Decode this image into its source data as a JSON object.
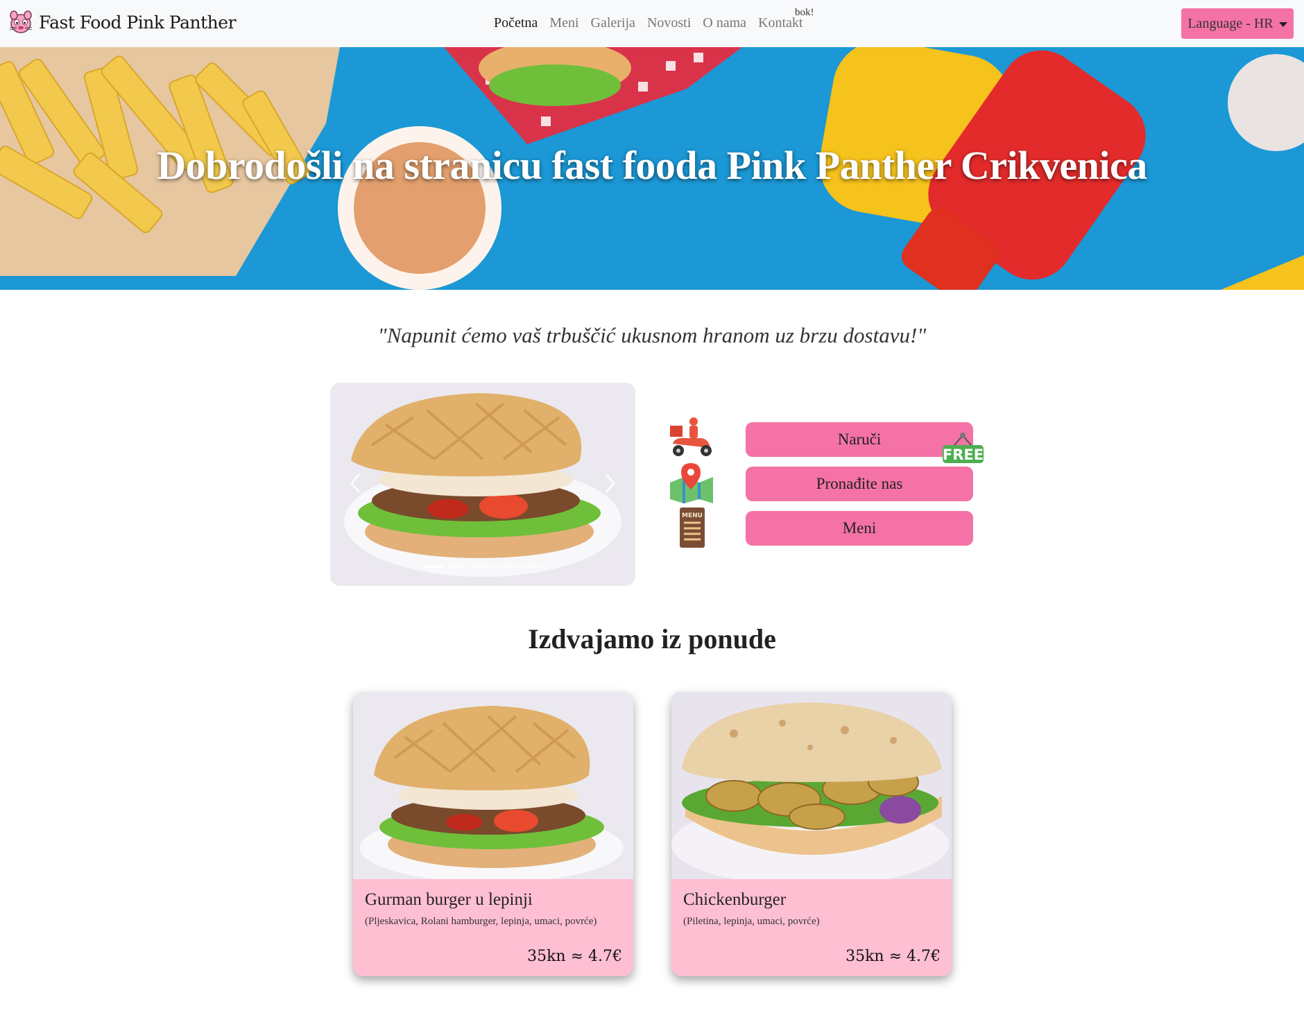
{
  "navbar": {
    "brand": "Fast Food Pink Panther",
    "links": [
      {
        "label": "Početna",
        "active": true
      },
      {
        "label": "Meni",
        "active": false
      },
      {
        "label": "Galerija",
        "active": false
      },
      {
        "label": "Novosti",
        "active": false
      },
      {
        "label": "O nama",
        "active": false
      },
      {
        "label": "Kontakt",
        "active": false
      }
    ],
    "extra_text": "bok!",
    "language_button": "Language - HR"
  },
  "hero": {
    "title": "Dobrodošli na stranicu fast fooda Pink Panther Crikvenica"
  },
  "quote": "\"Napunit ćemo vaš trbuščić ukusnom hranom uz brzu dostavu!\"",
  "carousel": {
    "slide_count": 5,
    "active_index": 0
  },
  "actions": [
    {
      "label": "Naruči",
      "icon": "delivery-scooter-icon",
      "badge": "FREE"
    },
    {
      "label": "Pronađite nas",
      "icon": "map-pin-icon"
    },
    {
      "label": "Meni",
      "icon": "menu-board-icon"
    }
  ],
  "featured": {
    "title": "Izdvajamo iz ponude",
    "items": [
      {
        "title": "Gurman burger u lepinji",
        "description": "(Pljeskavica, Rolani hamburger, lepinja, umaci, povrće)",
        "price": "35kn ≈ 4.7€"
      },
      {
        "title": "Chickenburger",
        "description": "(Piletina, lepinja, umaci, povrće)",
        "price": "35kn ≈ 4.7€"
      }
    ]
  },
  "colors": {
    "accent_pink": "#f472a5",
    "card_pink": "#ffbfd2",
    "navbar_bg": "#f8f9fa",
    "hero_blue": "#1a9ad6"
  }
}
